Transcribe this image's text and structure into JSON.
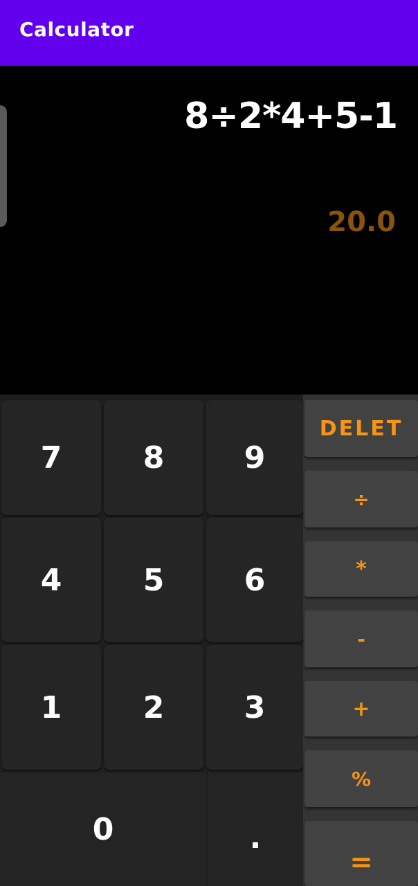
{
  "app_bar": {
    "title": "Calculator",
    "color": "#6200ee"
  },
  "display": {
    "expression": "8÷2*4+5-1",
    "result": "20.0",
    "result_color": "#8a5310"
  },
  "keypad": {
    "digits": {
      "seven": "7",
      "eight": "8",
      "nine": "9",
      "four": "4",
      "five": "5",
      "six": "6",
      "one": "1",
      "two": "2",
      "three": "3",
      "zero": "0",
      "dot": "."
    }
  },
  "operators": {
    "delete": "DELET",
    "divide": "÷",
    "multiply": "*",
    "subtract": "-",
    "add": "+",
    "percent": "%",
    "equals": "=",
    "accent_color": "#f79414"
  }
}
